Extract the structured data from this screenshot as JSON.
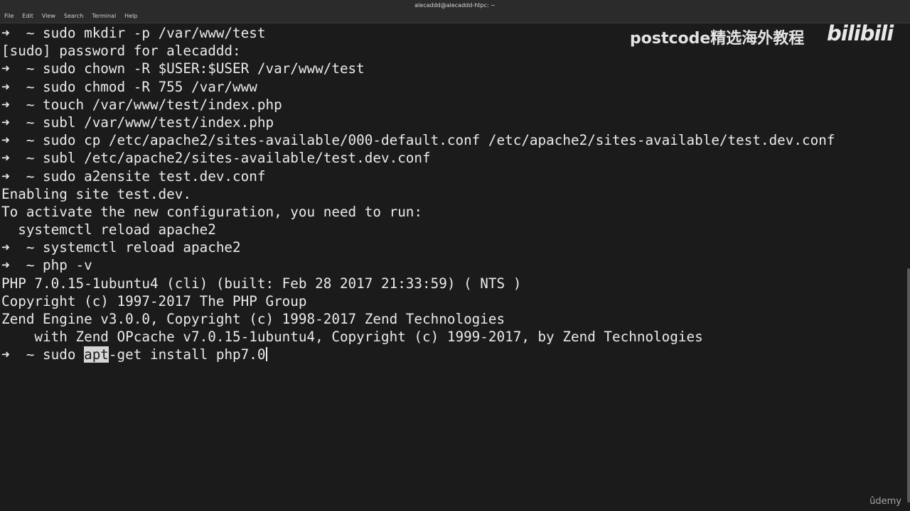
{
  "window": {
    "title": "alecaddd@alecaddd-htpc: ~",
    "menus": [
      "File",
      "Edit",
      "View",
      "Search",
      "Terminal",
      "Help"
    ]
  },
  "terminal": {
    "prompt_symbol": "➜  ~ ",
    "lines": [
      {
        "type": "cmd",
        "text": "sudo mkdir -p /var/www/test"
      },
      {
        "type": "out",
        "text": "[sudo] password for alecaddd:"
      },
      {
        "type": "cmd",
        "text": "sudo chown -R $USER:$USER /var/www/test"
      },
      {
        "type": "cmd",
        "text": "sudo chmod -R 755 /var/www"
      },
      {
        "type": "cmd",
        "text": "touch /var/www/test/index.php"
      },
      {
        "type": "cmd",
        "text": "subl /var/www/test/index.php"
      },
      {
        "type": "cmd",
        "text": "sudo cp /etc/apache2/sites-available/000-default.conf /etc/apache2/sites-available/test.dev.conf"
      },
      {
        "type": "cmd",
        "text": "subl /etc/apache2/sites-available/test.dev.conf"
      },
      {
        "type": "cmd",
        "text": "sudo a2ensite test.dev.conf"
      },
      {
        "type": "out",
        "text": "Enabling site test.dev."
      },
      {
        "type": "out",
        "text": "To activate the new configuration, you need to run:"
      },
      {
        "type": "out",
        "text": "  systemctl reload apache2"
      },
      {
        "type": "cmd",
        "text": "systemctl reload apache2"
      },
      {
        "type": "cmd",
        "text": "php -v"
      },
      {
        "type": "out",
        "text": "PHP 7.0.15-1ubuntu4 (cli) (built: Feb 28 2017 21:33:59) ( NTS )"
      },
      {
        "type": "out",
        "text": "Copyright (c) 1997-2017 The PHP Group"
      },
      {
        "type": "out",
        "text": "Zend Engine v3.0.0, Copyright (c) 1998-2017 Zend Technologies"
      },
      {
        "type": "out",
        "text": "    with Zend OPcache v7.0.15-1ubuntu4, Copyright (c) 1999-2017, by Zend Technologies"
      }
    ],
    "current_input": {
      "before": "sudo ",
      "highlighted": "apt",
      "after": "-get install php7.0"
    }
  },
  "overlay": {
    "watermark": "postcode精选海外教程",
    "bilibili": "bilibili",
    "udemy": "ûdemy"
  }
}
